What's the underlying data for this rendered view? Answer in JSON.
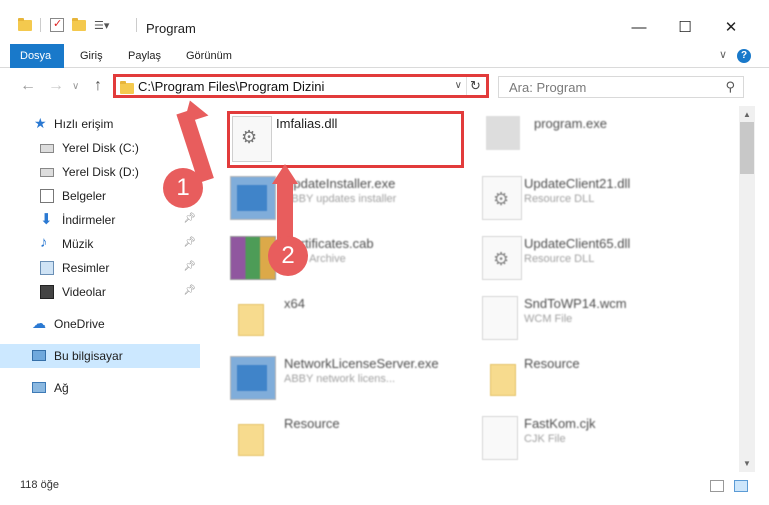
{
  "window": {
    "title": "Program",
    "minimize_icon": "minimize-icon",
    "maximize_icon": "maximize-icon",
    "close_icon": "close-icon"
  },
  "ribbon": {
    "tabs": [
      {
        "label": "Dosya",
        "active": true
      },
      {
        "label": "Giriş"
      },
      {
        "label": "Paylaş"
      },
      {
        "label": "Görünüm"
      }
    ],
    "help_label": "?"
  },
  "nav": {
    "address_path": "C:\\Program Files\\Program Dizini",
    "search_placeholder": "Ara: Program"
  },
  "sidebar": {
    "items": [
      {
        "label": "Hızlı erişim",
        "icon": "star-icon"
      },
      {
        "label": "Yerel Disk (C:)",
        "icon": "drive-icon"
      },
      {
        "label": "Yerel Disk (D:)",
        "icon": "drive-icon"
      },
      {
        "label": "Belgeler",
        "icon": "documents-icon"
      },
      {
        "label": "İndirmeler",
        "icon": "download-icon",
        "pinned": true
      },
      {
        "label": "Müzik",
        "icon": "music-icon",
        "pinned": true
      },
      {
        "label": "Resimler",
        "icon": "pictures-icon",
        "pinned": true
      },
      {
        "label": "Videolar",
        "icon": "videos-icon",
        "pinned": true
      },
      {
        "label": "OneDrive",
        "icon": "cloud-icon"
      },
      {
        "label": "Bu bilgisayar",
        "icon": "computer-icon",
        "selected": true
      },
      {
        "label": "Ağ",
        "icon": "network-icon"
      }
    ]
  },
  "files": [
    {
      "name": "Imfalias.dll",
      "sub": "",
      "thumb": "dll"
    },
    {
      "name": "program.exe",
      "sub": "",
      "thumb": "exe"
    },
    {
      "name": "UpdateInstaller.exe",
      "sub": "ABBY updates installer",
      "thumb": "win"
    },
    {
      "name": "UpdateClient21.dll",
      "sub": "Resource DLL",
      "thumb": "dll"
    },
    {
      "name": "Certificates.cab",
      "sub": "CAB Archive",
      "thumb": "rar"
    },
    {
      "name": "UpdateClient65.dll",
      "sub": "Resource DLL",
      "thumb": "dll"
    },
    {
      "name": "x64",
      "sub": "",
      "thumb": "folder"
    },
    {
      "name": "SndToWP14.wcm",
      "sub": "WCM File",
      "thumb": "doc"
    },
    {
      "name": "NetworkLicenseServer.exe",
      "sub": "ABBY network licens...",
      "thumb": "win"
    },
    {
      "name": "Resource",
      "sub": "",
      "thumb": "folder"
    },
    {
      "name": "Resource",
      "sub": "",
      "thumb": "folder"
    },
    {
      "name": "FastKom.cjk",
      "sub": "CJK File",
      "thumb": "doc"
    }
  ],
  "status": {
    "count": "118 öğe"
  },
  "annotations": {
    "step1": "1",
    "step2": "2",
    "accent_color": "#e23b3b"
  }
}
